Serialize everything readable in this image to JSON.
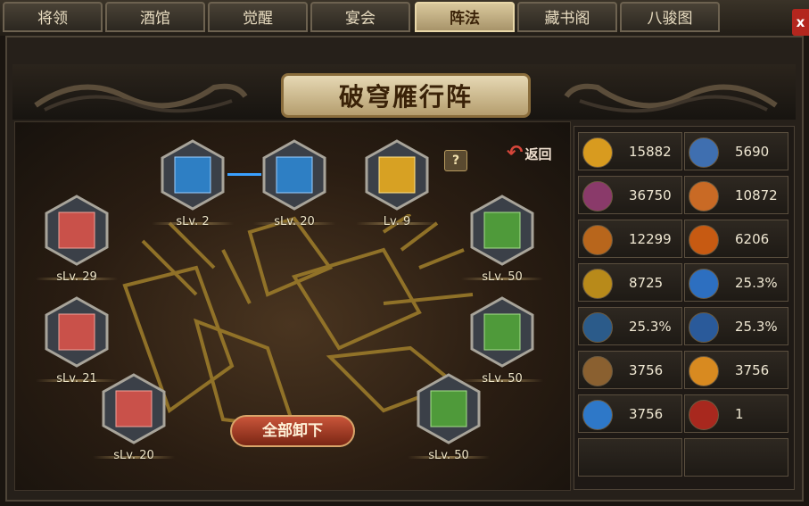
{
  "tabs": [
    {
      "label": "将领",
      "active": false
    },
    {
      "label": "酒馆",
      "active": false
    },
    {
      "label": "觉醒",
      "active": false
    },
    {
      "label": "宴会",
      "active": false
    },
    {
      "label": "阵法",
      "active": true
    },
    {
      "label": "藏书阁",
      "active": false
    },
    {
      "label": "八骏图",
      "active": false
    }
  ],
  "close_label": "x",
  "title": "破穹雁行阵",
  "back_label": "返回",
  "help_label": "?",
  "unload_all_label": "全部卸下",
  "slots": [
    {
      "color": "blue",
      "level": "sLv. 2"
    },
    {
      "color": "blue",
      "level": "sLv. 20"
    },
    {
      "color": "gold",
      "level": "Lv. 9"
    },
    {
      "color": "red",
      "level": "sLv. 29"
    },
    {
      "color": "green",
      "level": "sLv. 50"
    },
    {
      "color": "red",
      "level": "sLv. 21"
    },
    {
      "color": "green",
      "level": "sLv. 50"
    },
    {
      "color": "red",
      "level": "sLv. 20"
    },
    {
      "color": "green",
      "level": "sLv. 50"
    }
  ],
  "stats": [
    {
      "icon": "sword-icon",
      "value": "15882",
      "color": "#d89b1f"
    },
    {
      "icon": "shield-icon",
      "value": "5690",
      "color": "#3f6fb0"
    },
    {
      "icon": "burst-icon",
      "value": "36750",
      "color": "#8a3a6a"
    },
    {
      "icon": "warrior-icon",
      "value": "10872",
      "color": "#c96a25"
    },
    {
      "icon": "hammer-icon",
      "value": "12299",
      "color": "#b8661c"
    },
    {
      "icon": "flame-face-icon",
      "value": "6206",
      "color": "#c75a12"
    },
    {
      "icon": "tome-icon",
      "value": "8725",
      "color": "#b88a1a"
    },
    {
      "icon": "swirl-blue-icon",
      "value": "25.3%",
      "color": "#2d6fc0"
    },
    {
      "icon": "strike-icon",
      "value": "25.3%",
      "color": "#2b5b8a"
    },
    {
      "icon": "slash-blue-icon",
      "value": "25.3%",
      "color": "#2a5a9a"
    },
    {
      "icon": "lion-icon",
      "value": "3756",
      "color": "#8a6030"
    },
    {
      "icon": "sun-icon",
      "value": "3756",
      "color": "#d88a20"
    },
    {
      "icon": "wave-icon",
      "value": "3756",
      "color": "#2e78c8"
    },
    {
      "icon": "dragon-red-icon",
      "value": "1",
      "color": "#a8281e"
    }
  ]
}
